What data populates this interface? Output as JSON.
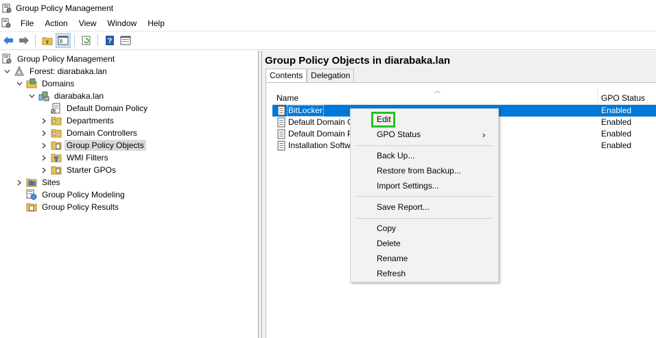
{
  "window": {
    "title": "Group Policy Management"
  },
  "menubar": {
    "items": [
      "File",
      "Action",
      "View",
      "Window",
      "Help"
    ]
  },
  "toolbar": {
    "buttons": [
      "back-icon",
      "forward-icon",
      "up-folder-icon",
      "show-hide-tree-icon",
      "refresh-icon",
      "help-icon",
      "properties-icon"
    ]
  },
  "tree": {
    "items": [
      {
        "label": "Group Policy Management",
        "icon": "gpm-console-icon"
      },
      {
        "label": "Forest: diarabaka.lan",
        "icon": "forest-icon"
      },
      {
        "label": "Domains",
        "icon": "domains-folder-icon"
      },
      {
        "label": "diarabaka.lan",
        "icon": "domain-icon"
      },
      {
        "label": "Default Domain Policy",
        "icon": "gpo-link-icon"
      },
      {
        "label": "Departments",
        "icon": "ou-folder-icon"
      },
      {
        "label": "Domain Controllers",
        "icon": "ou-folder-icon"
      },
      {
        "label": "Group Policy Objects",
        "icon": "gpo-folder-icon"
      },
      {
        "label": "WMI Filters",
        "icon": "wmi-folder-icon"
      },
      {
        "label": "Starter GPOs",
        "icon": "starter-folder-icon"
      },
      {
        "label": "Sites",
        "icon": "sites-icon"
      },
      {
        "label": "Group Policy Modeling",
        "icon": "modeling-icon"
      },
      {
        "label": "Group Policy Results",
        "icon": "results-icon"
      }
    ]
  },
  "main": {
    "title": "Group Policy Objects in diarabaka.lan",
    "tabs": [
      "Contents",
      "Delegation"
    ],
    "columns": [
      "Name",
      "GPO Status"
    ],
    "rows": [
      {
        "name": "BitLocker",
        "status": "Enabled"
      },
      {
        "name": "Default Domain Cor",
        "status": "Enabled"
      },
      {
        "name": "Default Domain Pol",
        "status": "Enabled"
      },
      {
        "name": "Installation Software",
        "status": "Enabled"
      }
    ]
  },
  "context_menu": {
    "items": [
      "Edit",
      "GPO Status",
      "Back Up...",
      "Restore from Backup...",
      "Import Settings...",
      "Save Report...",
      "Copy",
      "Delete",
      "Rename",
      "Refresh"
    ],
    "submenu_arrow": "›"
  },
  "colors": {
    "selection": "#0078d7",
    "highlight_box": "#22c322"
  }
}
